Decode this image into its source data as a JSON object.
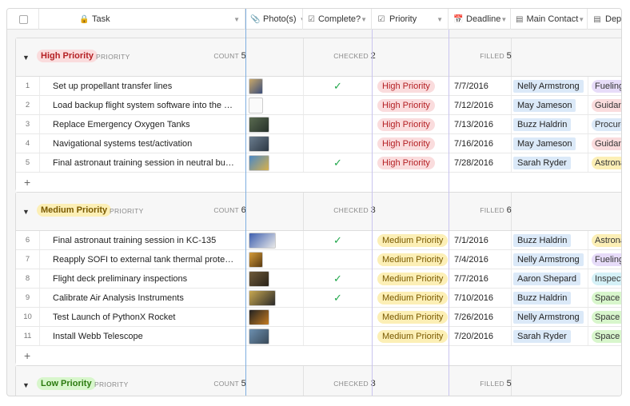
{
  "columns": {
    "task": "Task",
    "photos": "Photo(s)",
    "complete": "Complete?",
    "priority": "Priority",
    "deadline": "Deadline",
    "main_contact": "Main Contact",
    "department": "Depar"
  },
  "labels": {
    "priority_sub": "PRIORITY",
    "count": "COUNT",
    "checked": "CHECKED",
    "filled": "FILLED",
    "add": "+",
    "checkmark": "✓"
  },
  "colors": {
    "high_bg": "#fadcdd",
    "medium_bg": "#fcefb6",
    "low_bg": "#d8f6cc",
    "check": "#20a74a",
    "frozen_line": "#7eaee0"
  },
  "groups": [
    {
      "title": "High Priority",
      "count": "5",
      "checked": "2",
      "filled": "5",
      "rows": [
        {
          "n": "1",
          "task": "Set up propellant transfer lines",
          "photo": "photo-thumb",
          "done": true,
          "priority": "High Priority",
          "deadline": "7/7/2016",
          "contact": "Nelly Armstrong",
          "dept": "Fueling"
        },
        {
          "n": "2",
          "task": "Load backup flight system software into the orbiter",
          "photo": "doc-thumb",
          "done": false,
          "priority": "High Priority",
          "deadline": "7/12/2016",
          "contact": "May Jameson",
          "dept": "Guidanc"
        },
        {
          "n": "3",
          "task": "Replace Emergency Oxygen Tanks",
          "photo": "photo-thumb",
          "done": false,
          "priority": "High Priority",
          "deadline": "7/13/2016",
          "contact": "Buzz Haldrin",
          "dept": "Procure"
        },
        {
          "n": "4",
          "task": "Navigational systems test/activation",
          "photo": "photo-thumb",
          "done": false,
          "priority": "High Priority",
          "deadline": "7/16/2016",
          "contact": "May Jameson",
          "dept": "Guidanc"
        },
        {
          "n": "5",
          "task": "Final astronaut training session in neutral buoyan...",
          "photo": "photo-thumb",
          "done": true,
          "priority": "High Priority",
          "deadline": "7/28/2016",
          "contact": "Sarah Ryder",
          "dept": "Astrona"
        }
      ]
    },
    {
      "title": "Medium Priority",
      "count": "6",
      "checked": "3",
      "filled": "6",
      "rows": [
        {
          "n": "6",
          "task": "Final astronaut training session in KC-135",
          "photo": "photo-thumb",
          "done": true,
          "priority": "Medium Priority",
          "deadline": "7/1/2016",
          "contact": "Buzz Haldrin",
          "dept": "Astrona"
        },
        {
          "n": "7",
          "task": "Reapply SOFI to external tank thermal protection...",
          "photo": "photo-thumb",
          "done": false,
          "priority": "Medium Priority",
          "deadline": "7/4/2016",
          "contact": "Nelly Armstrong",
          "dept": "Fueling"
        },
        {
          "n": "8",
          "task": "Flight deck preliminary inspections",
          "photo": "photo-thumb",
          "done": true,
          "priority": "Medium Priority",
          "deadline": "7/7/2016",
          "contact": "Aaron Shepard",
          "dept": "Inspecti"
        },
        {
          "n": "9",
          "task": "Calibrate Air Analysis Instruments",
          "photo": "photo-thumb",
          "done": true,
          "priority": "Medium Priority",
          "deadline": "7/10/2016",
          "contact": "Buzz Haldrin",
          "dept": "Space T"
        },
        {
          "n": "10",
          "task": "Test Launch of PythonX Rocket",
          "photo": "photo-thumb",
          "done": false,
          "priority": "Medium Priority",
          "deadline": "7/26/2016",
          "contact": "Nelly Armstrong",
          "dept": "Space T"
        },
        {
          "n": "11",
          "task": "Install Webb Telescope",
          "photo": "photo-thumb",
          "done": false,
          "priority": "Medium Priority",
          "deadline": "7/20/2016",
          "contact": "Sarah Ryder",
          "dept": "Space T"
        }
      ]
    },
    {
      "title": "Low Priority",
      "count": "5",
      "checked": "3",
      "filled": "5",
      "rows": []
    }
  ]
}
